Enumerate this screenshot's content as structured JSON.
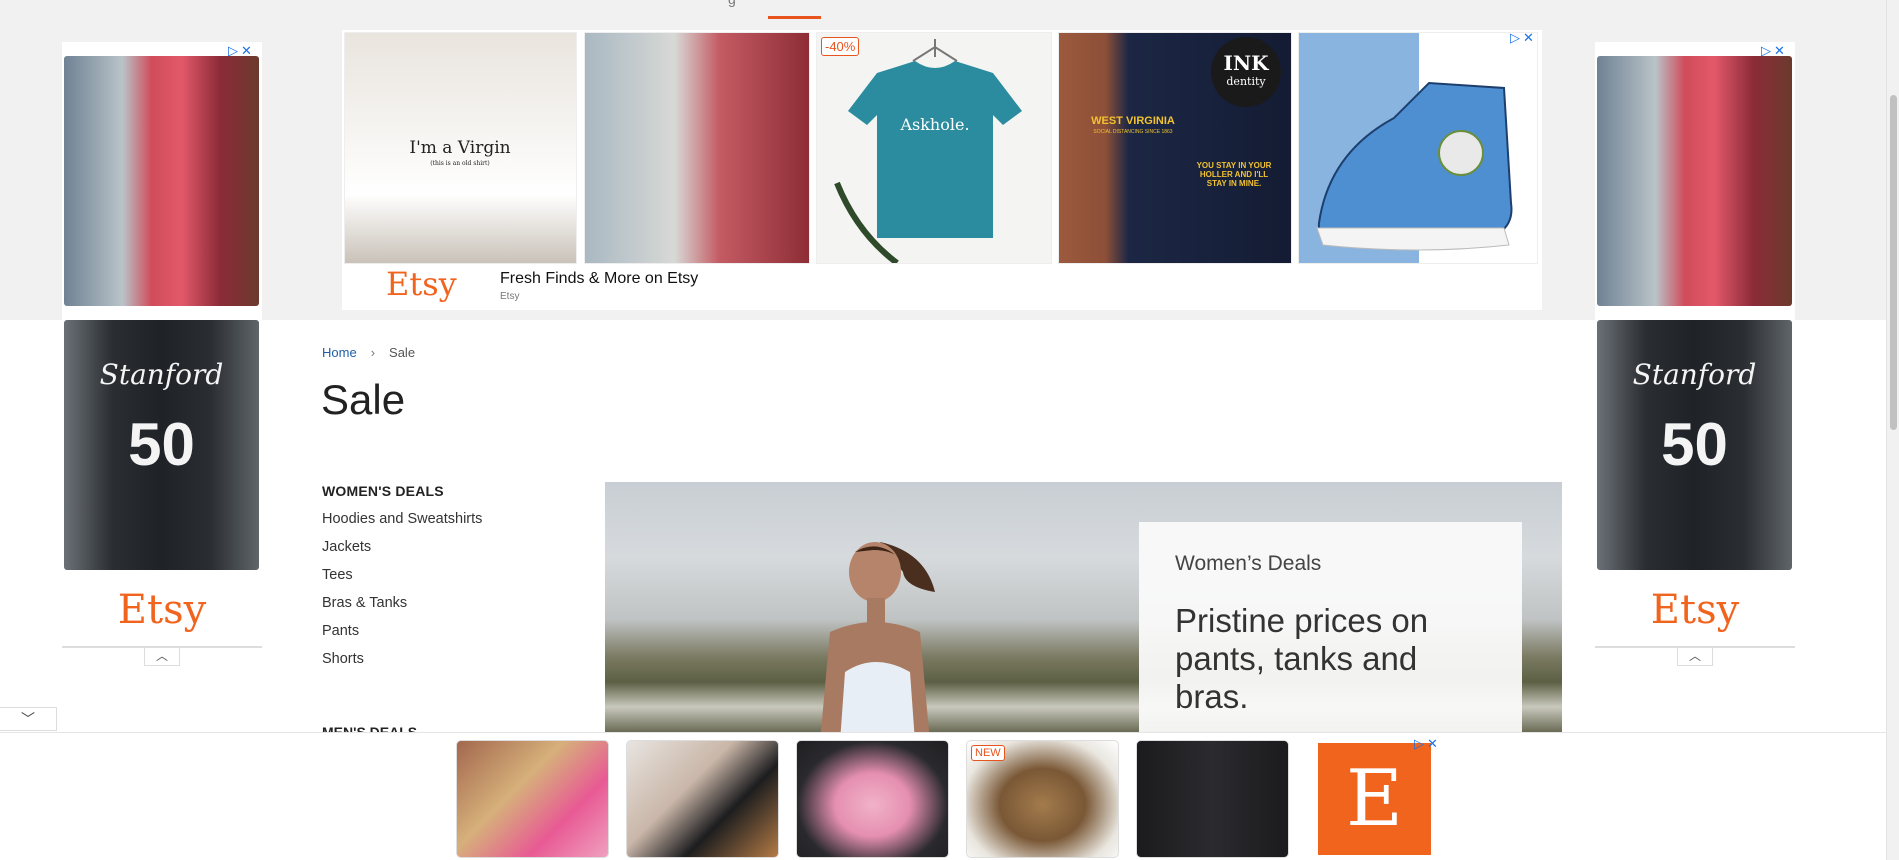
{
  "nav": {
    "fragment": "g"
  },
  "top_ad": {
    "tile_text_virgin": "I'm a Virgin",
    "tile_text_virgin_sub": "(this is an old shirt)",
    "badge": "-40%",
    "tile_text_askhole": "Askhole.",
    "tile_text_wv": "WEST VIRGINIA",
    "tile_text_wv_sub": "SOCIAL DISTANCING SINCE 1863",
    "tile_text_holler": "YOU STAY IN YOUR HOLLER AND I'LL STAY IN MINE.",
    "tile_text_ink": "INK",
    "tile_text_ink_sub": "dentity",
    "logo": "Etsy",
    "title": "Fresh Finds & More on Etsy",
    "subtitle": "Etsy"
  },
  "side_ads": {
    "jacket_name": "Stanford",
    "jacket_number": "50",
    "logo": "Etsy"
  },
  "breadcrumb": {
    "home": "Home",
    "separator": "›",
    "current": "Sale"
  },
  "page_title": "Sale",
  "menu": {
    "heading": "WOMEN'S DEALS",
    "items": [
      "Hoodies and Sweatshirts",
      "Jackets",
      "Tees",
      "Bras & Tanks",
      "Pants",
      "Shorts"
    ],
    "heading2": "MEN'S DEALS"
  },
  "hero": {
    "eyebrow": "Women’s Deals",
    "headline": "Pristine prices on pants, tanks and bras."
  },
  "bottom_ad": {
    "new_badge": "NEW",
    "logo_letter": "E"
  },
  "icons": {
    "ad_choices": "ad-choices-icon",
    "close": "close-icon",
    "chevron_up": "chevron-up-icon",
    "chevron_down": "chevron-down-icon"
  },
  "colors": {
    "accent": "#e8541e",
    "etsy": "#f1641e",
    "link": "#1f5fa8"
  }
}
